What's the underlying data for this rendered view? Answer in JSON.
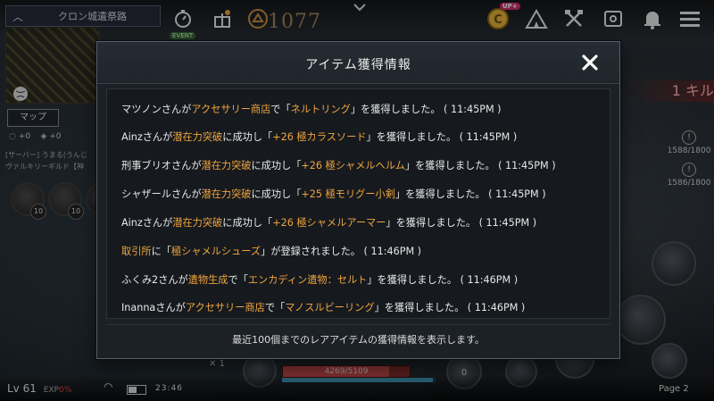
{
  "hud": {
    "location_name": "クロン城遺祭路",
    "event_label": "EVENT",
    "score": "1077",
    "up_badge": "UP+",
    "map_button": "マップ",
    "stat_a": "+0",
    "stat_b": "+0",
    "chat_line_1": "[サーバー] うまる(うんじ",
    "chat_line_2": "ヴァルキリーギルド【神",
    "slot_counts": [
      "10",
      "10"
    ],
    "kill_label": "1 キル",
    "right_status": [
      "1588/1800",
      "1586/1800"
    ],
    "level": "Lv 61",
    "exp_label": "EXP",
    "exp_pct": "0%",
    "clock": "23:46",
    "hp_text": "4269/5109",
    "hp_fraction": 0.8356,
    "mp_fraction": 0.98,
    "page_label": "Page 2",
    "skill_count": "1",
    "skill_zero": "0"
  },
  "modal": {
    "title": "アイテム獲得情報",
    "footer": "最近100個までのレアアイテムの獲得情報を表示します。",
    "lines": [
      {
        "a": "マツノンさんが",
        "b": "アクセサリー商店",
        "c": "で「",
        "d": "ネルトリング",
        "e": "」を獲得しました。 ( 11:45PM )"
      },
      {
        "a": "Ainzさんが",
        "b": "潜在力突破",
        "c": "に成功し「",
        "d": "+26 極カラスソード",
        "e": "」を獲得しました。 ( 11:45PM )"
      },
      {
        "a": "刑事ブリオさんが",
        "b": "潜在力突破",
        "c": "に成功し「",
        "d": "+26 極シャメルヘルム",
        "e": "」を獲得しました。 ( 11:45PM )"
      },
      {
        "a": "シャザールさんが",
        "b": "潜在力突破",
        "c": "に成功し「",
        "d": "+25 極モリグー小剣",
        "e": "」を獲得しました。 ( 11:45PM )"
      },
      {
        "a": "Ainzさんが",
        "b": "潜在力突破",
        "c": "に成功し「",
        "d": "+26 極シャメルアーマー",
        "e": "」を獲得しました。 ( 11:45PM )"
      },
      {
        "a": "",
        "b": "取引所",
        "c": "に「",
        "d": "極シャメルシューズ",
        "e": "」が登録されました。 ( 11:46PM )"
      },
      {
        "a": "ふくみ2さんが",
        "b": "遺物生成",
        "c": "で「",
        "d": "エンカディン遺物：セルト",
        "e": "」を獲得しました。 ( 11:46PM )"
      },
      {
        "a": "Inannaさんが",
        "b": "アクセサリー商店",
        "c": "で「",
        "d": "マノスルビーリング",
        "e": "」を獲得しました。 ( 11:46PM )"
      }
    ]
  }
}
